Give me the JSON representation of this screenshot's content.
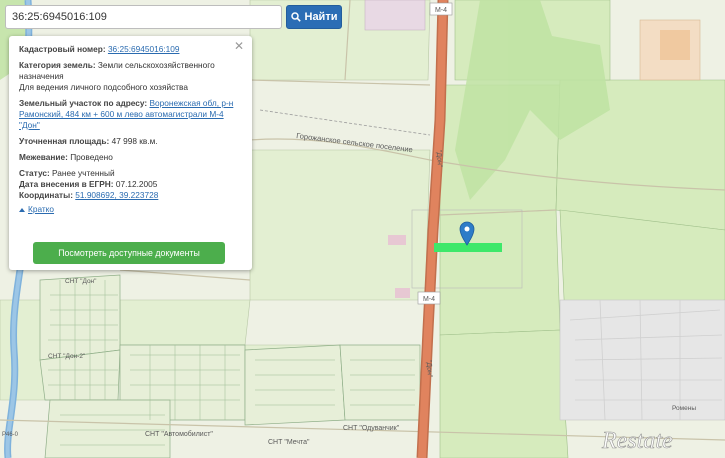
{
  "search": {
    "value": "36:25:6945016:109",
    "button_label": "Найти",
    "button_icon": "search-icon"
  },
  "info": {
    "cadastral_label": "Кадастровый номер:",
    "cadastral_value": "36:25:6945016:109",
    "category_label": "Категория земель:",
    "category_value": "Земли сельскохозяйственного назначения",
    "use_value": "Для ведения личного подсобного хозяйства",
    "address_label": "Земельный участок по адресу:",
    "address_value": "Воронежская обл, р-н Рамонский, 484 км + 600 м лево автомагистрали М-4 \"Дон\"",
    "area_label": "Уточненная площадь:",
    "area_value": "47 998 кв.м.",
    "survey_label": "Межевание:",
    "survey_value": "Проведено",
    "status_label": "Статус:",
    "status_value": "Ранее учтенный",
    "date_label": "Дата внесения в ЕГРН:",
    "date_value": "07.12.2005",
    "coords_label": "Координаты:",
    "coords_value": "51.908692, 39.223728",
    "collapse_label": "Кратко",
    "docs_button": "Посмотреть доступные документы"
  },
  "map_labels": {
    "highway_top": "М-4",
    "highway_mid": "М-4",
    "don_upper": "\"Дон\"",
    "don_lower": "\"Дон\"",
    "settlement": "Горожанское сельское поселение",
    "snt_don": "СНТ \"Дон\"",
    "snt_don2": "СНТ \"Дон-2\"",
    "snt_auto": "СНТ \"Автомобилист\"",
    "snt_dream": "СНТ \"Мечта\"",
    "snt_odu": "СНТ \"Одуванчик\"",
    "romeny": "Ромены",
    "road_left": "Р46-0"
  },
  "watermark": "Restate",
  "colors": {
    "highway": "#e0835e",
    "river": "#7fb2dc",
    "parcel": "#3ee86a",
    "marker": "#2d7cc8",
    "field": "#d9ebc2",
    "forest": "#bee3a2",
    "button": "#4cae4c",
    "find_button": "#2b6db5"
  }
}
